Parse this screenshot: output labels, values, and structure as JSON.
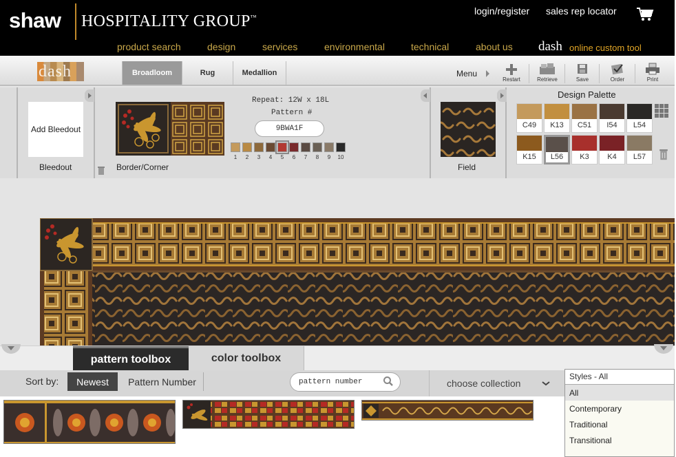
{
  "header": {
    "brand_name": "shaw",
    "brand_sub": "HOSPITALITY GROUP",
    "brand_tm": "™",
    "login_link": "login/register",
    "sales_link": "sales rep locator",
    "cart_icon": "shopping-cart-icon",
    "nav": [
      "product search",
      "design",
      "services",
      "environmental",
      "technical",
      "about us"
    ],
    "dash_word": "dash",
    "dash_sub": "online custom tool",
    "nav_color": "#c9a84a",
    "dash_sub_color": "#e0a526"
  },
  "toolbar": {
    "logo_text": "dash",
    "tabs": [
      "Broadloom",
      "Rug",
      "Medallion"
    ],
    "active_tab": "Broadloom",
    "menu_label": "Menu",
    "actions": [
      {
        "label": "Restart",
        "icon": "plus-icon"
      },
      {
        "label": "Retrieve",
        "icon": "retrieve-icon"
      },
      {
        "label": "Save",
        "icon": "save-icon"
      },
      {
        "label": "Order",
        "icon": "order-icon"
      },
      {
        "label": "Print",
        "icon": "printer-icon"
      }
    ]
  },
  "design": {
    "bleedout_box": "Add Bleedout",
    "bleedout_label": "Bleedout",
    "border_label": "Border/Corner",
    "repeat": "Repeat: 12W x 18L",
    "pattern_label": "Pattern #",
    "pattern_value": "9BWA1F",
    "chip_numbers": [
      "1",
      "2",
      "3",
      "4",
      "5",
      "6",
      "7",
      "8",
      "9",
      "10"
    ],
    "chip_colors": [
      "#c49a5c",
      "#b98a44",
      "#8e6a3c",
      "#6a4b34",
      "#b23a32",
      "#7a2a2c",
      "#5a4a42",
      "#6a6055",
      "#8a7a68",
      "#2a2a2a"
    ],
    "selected_chip": "5",
    "field_label": "Field",
    "palette_title": "Design Palette",
    "palette": [
      {
        "code": "C49",
        "color": "#c49a5c"
      },
      {
        "code": "K13",
        "color": "#c28f3f"
      },
      {
        "code": "C51",
        "color": "#9a7244"
      },
      {
        "code": "I54",
        "color": "#4a3a30"
      },
      {
        "code": "L54",
        "color": "#2a2826"
      },
      {
        "code": "K15",
        "color": "#8c5a1e"
      },
      {
        "code": "L56",
        "color": "#5a504a"
      },
      {
        "code": "K3",
        "color": "#a8302c"
      },
      {
        "code": "K4",
        "color": "#7a2226"
      },
      {
        "code": "L57",
        "color": "#8a7a64"
      }
    ],
    "selected_palette": "L56"
  },
  "toolbox": {
    "tabs": [
      "pattern toolbox",
      "color toolbox"
    ],
    "active_tab": "pattern toolbox",
    "sort_label": "Sort by:",
    "sort_options": [
      "Newest",
      "Pattern Number"
    ],
    "active_sort": "Newest",
    "search_placeholder": "pattern number",
    "collection_placeholder": "choose collection",
    "styles_header": "Styles - All",
    "styles_options": [
      "All",
      "Contemporary",
      "Traditional",
      "Transitional"
    ],
    "selected_style": "All"
  }
}
